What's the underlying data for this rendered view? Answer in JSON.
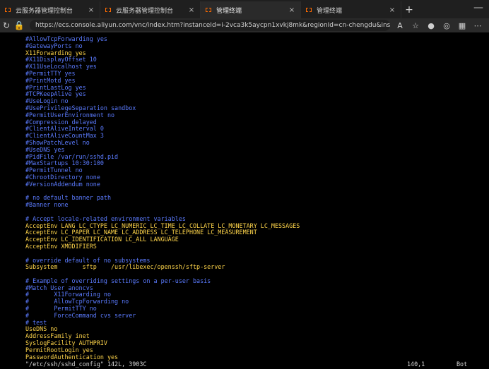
{
  "browser": {
    "tabs": [
      {
        "title": "云服务器管理控制台",
        "active": false
      },
      {
        "title": "云服务器管理控制台",
        "active": false
      },
      {
        "title": "管理终端",
        "active": true
      },
      {
        "title": "管理终端",
        "active": false
      }
    ],
    "url": "https://ecs.console.aliyun.com/vnc/index.htm?instanceId=i-2vca3k5aycpn1xvkj8mk&regionId=cn-chengdu&instanceName=a...",
    "tools": {
      "read": "A",
      "star": "☆"
    }
  },
  "terminal": {
    "lines": [
      {
        "text": "#AllowTcpForwarding yes",
        "color": "blue"
      },
      {
        "text": "#GatewayPorts no",
        "color": "blue"
      },
      {
        "text": "X11Forwarding yes",
        "color": "yellow"
      },
      {
        "text": "#X11DisplayOffset 10",
        "color": "blue"
      },
      {
        "text": "#X11UseLocalhost yes",
        "color": "blue"
      },
      {
        "text": "#PermitTTY yes",
        "color": "blue"
      },
      {
        "text": "#PrintMotd yes",
        "color": "blue"
      },
      {
        "text": "#PrintLastLog yes",
        "color": "blue"
      },
      {
        "text": "#TCPKeepAlive yes",
        "color": "blue"
      },
      {
        "text": "#UseLogin no",
        "color": "blue"
      },
      {
        "text": "#UsePrivilegeSeparation sandbox",
        "color": "blue"
      },
      {
        "text": "#PermitUserEnvironment no",
        "color": "blue"
      },
      {
        "text": "#Compression delayed",
        "color": "blue"
      },
      {
        "text": "#ClientAliveInterval 0",
        "color": "blue"
      },
      {
        "text": "#ClientAliveCountMax 3",
        "color": "blue"
      },
      {
        "text": "#ShowPatchLevel no",
        "color": "blue"
      },
      {
        "text": "#UseDNS yes",
        "color": "blue"
      },
      {
        "text": "#PidFile /var/run/sshd.pid",
        "color": "blue"
      },
      {
        "text": "#MaxStartups 10:30:100",
        "color": "blue"
      },
      {
        "text": "#PermitTunnel no",
        "color": "blue"
      },
      {
        "text": "#ChrootDirectory none",
        "color": "blue"
      },
      {
        "text": "#VersionAddendum none",
        "color": "blue"
      },
      {
        "text": "",
        "color": "gray"
      },
      {
        "text": "# no default banner path",
        "color": "blue"
      },
      {
        "text": "#Banner none",
        "color": "blue"
      },
      {
        "text": "",
        "color": "gray"
      },
      {
        "text": "# Accept locale-related environment variables",
        "color": "blue"
      },
      {
        "text": "AcceptEnv LANG LC_CTYPE LC_NUMERIC LC_TIME LC_COLLATE LC_MONETARY LC_MESSAGES",
        "color": "yellow"
      },
      {
        "text": "AcceptEnv LC_PAPER LC_NAME LC_ADDRESS LC_TELEPHONE LC_MEASUREMENT",
        "color": "yellow"
      },
      {
        "text": "AcceptEnv LC_IDENTIFICATION LC_ALL LANGUAGE",
        "color": "yellow"
      },
      {
        "text": "AcceptEnv XMODIFIERS",
        "color": "yellow"
      },
      {
        "text": "",
        "color": "gray"
      },
      {
        "text": "# override default of no subsystems",
        "color": "blue"
      },
      {
        "text": "Subsystem       sftp    /usr/libexec/openssh/sftp-server",
        "color": "yellow"
      },
      {
        "text": "",
        "color": "gray"
      },
      {
        "text": "# Example of overriding settings on a per-user basis",
        "color": "blue"
      },
      {
        "text": "#Match User anoncvs",
        "color": "blue"
      },
      {
        "text": "#       X11Forwarding no",
        "color": "blue"
      },
      {
        "text": "#       AllowTcpForwarding no",
        "color": "blue"
      },
      {
        "text": "#       PermitTTY no",
        "color": "blue"
      },
      {
        "text": "#       ForceCommand cvs server",
        "color": "blue"
      },
      {
        "text": "# test",
        "color": "blue"
      },
      {
        "text": "UseDNS no",
        "color": "yellow"
      },
      {
        "text": "AddressFamily inet",
        "color": "yellow"
      },
      {
        "text": "SyslogFacility AUTHPRIV",
        "color": "yellow"
      },
      {
        "text": "PermitRootLogin yes",
        "color": "yellow"
      },
      {
        "text": "PasswordAuthentication yes",
        "color": "yellow"
      }
    ],
    "status": {
      "left": "\"/etc/ssh/sshd_config\" 142L, 3903C",
      "mid": "140,1",
      "right": "Bot"
    }
  }
}
